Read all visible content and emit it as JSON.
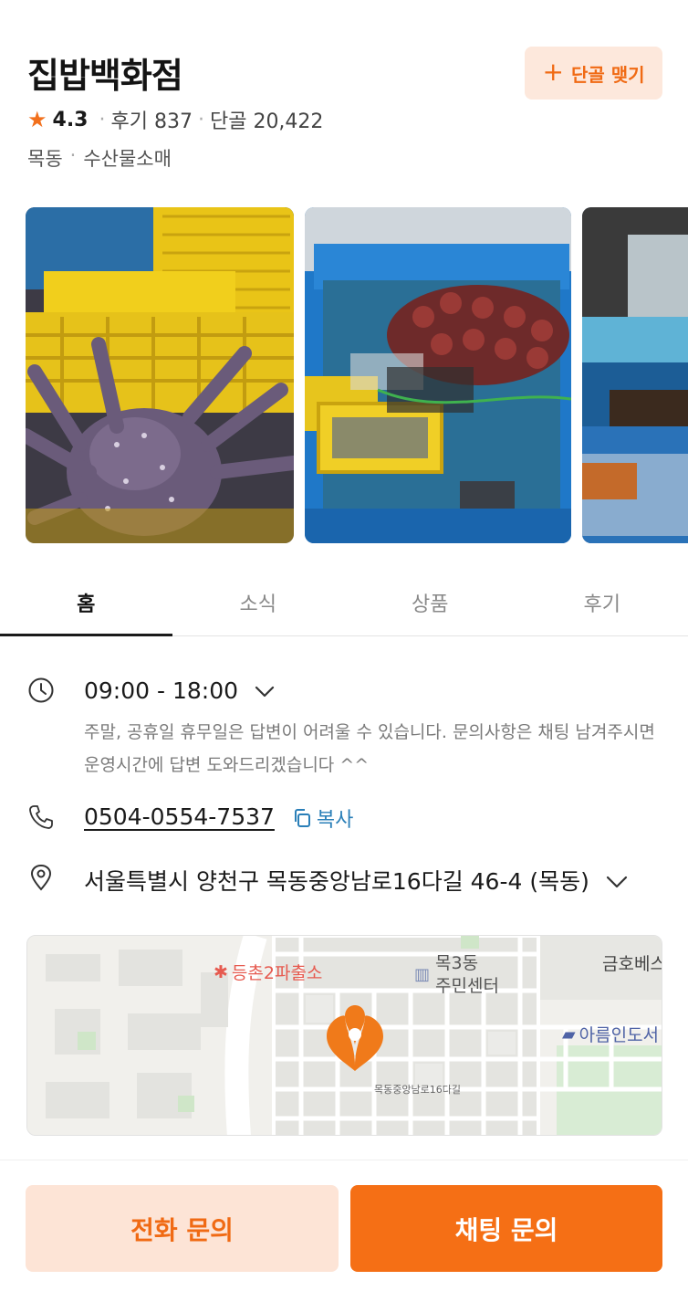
{
  "store": {
    "name": "집밥백화점",
    "regular_button": {
      "icon": "plus-icon",
      "label": "단골 맺기"
    },
    "rating": "4.3",
    "review_text": "후기 837",
    "regulars_text": "단골 20,422",
    "area": "목동",
    "category": "수산물소매"
  },
  "tabs": [
    {
      "label": "홈",
      "active": true
    },
    {
      "label": "소식",
      "active": false
    },
    {
      "label": "상품",
      "active": false
    },
    {
      "label": "후기",
      "active": false
    }
  ],
  "info": {
    "hours": "09:00 - 18:00",
    "hours_note": "주말, 공휴일 휴무일은 답변이 어려울 수 있습니다. 문의사항은 채팅 남겨주시면 운영시간에 답변 도와드리겠습니다 ^^",
    "phone": "0504-0554-7537",
    "copy_label": "복사",
    "address": "서울특별시 양천구 목동중앙남로16다길 46-4 (목동)"
  },
  "map": {
    "labels": {
      "police": "등촌2파출소",
      "community_line1": "목3동",
      "community_line2": "주민센터",
      "kumho": "금호베스",
      "library": "아름인도서",
      "road": "목동중앙남로16다길"
    }
  },
  "actions": {
    "call_label": "전화 문의",
    "chat_label": "채팅 문의"
  },
  "colors": {
    "accent": "#f56f15",
    "accent_light": "#fde4d6",
    "link": "#2a7fb8"
  }
}
